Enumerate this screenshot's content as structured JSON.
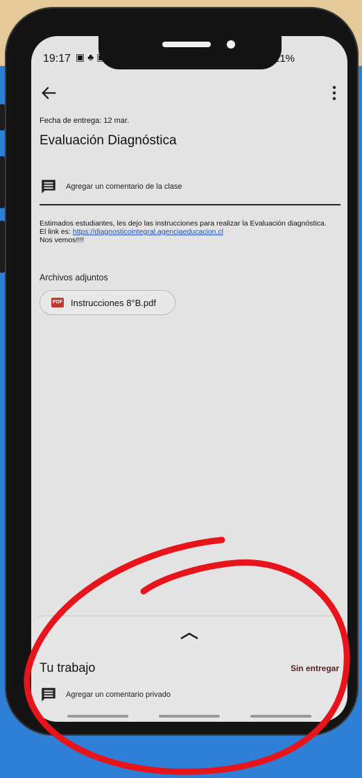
{
  "status_bar": {
    "time": "19:17",
    "battery": "21%"
  },
  "toolbar": {
    "back_icon": "arrow-left-icon",
    "more_icon": "more-vertical-icon"
  },
  "assignment": {
    "due": "Fecha de entrega: 12 mar.",
    "title": "Evaluación Diagnóstica",
    "class_comment": "Agregar un comentario de la clase",
    "description_line1": "Estimados estudiantes, les dejo las instrucciones para realizar la Evaluación diagnóstica.",
    "link_prefix": "El link es: ",
    "link_text": "https://diagnosticointegral.agenciaeducacion.cl",
    "description_line3": "Nos vemos!!!!",
    "attachments_label": "Archivos adjuntos",
    "attachment_name": "Instrucciones 8°B.pdf",
    "attachment_icon_text": "PDF"
  },
  "work": {
    "title": "Tu trabajo",
    "status": "Sin entregar",
    "private_comment": "Agregar un comentario privado"
  },
  "colors": {
    "annotation": "#e8141b",
    "link": "#1f4fb3",
    "status": "#5a1f1f"
  }
}
